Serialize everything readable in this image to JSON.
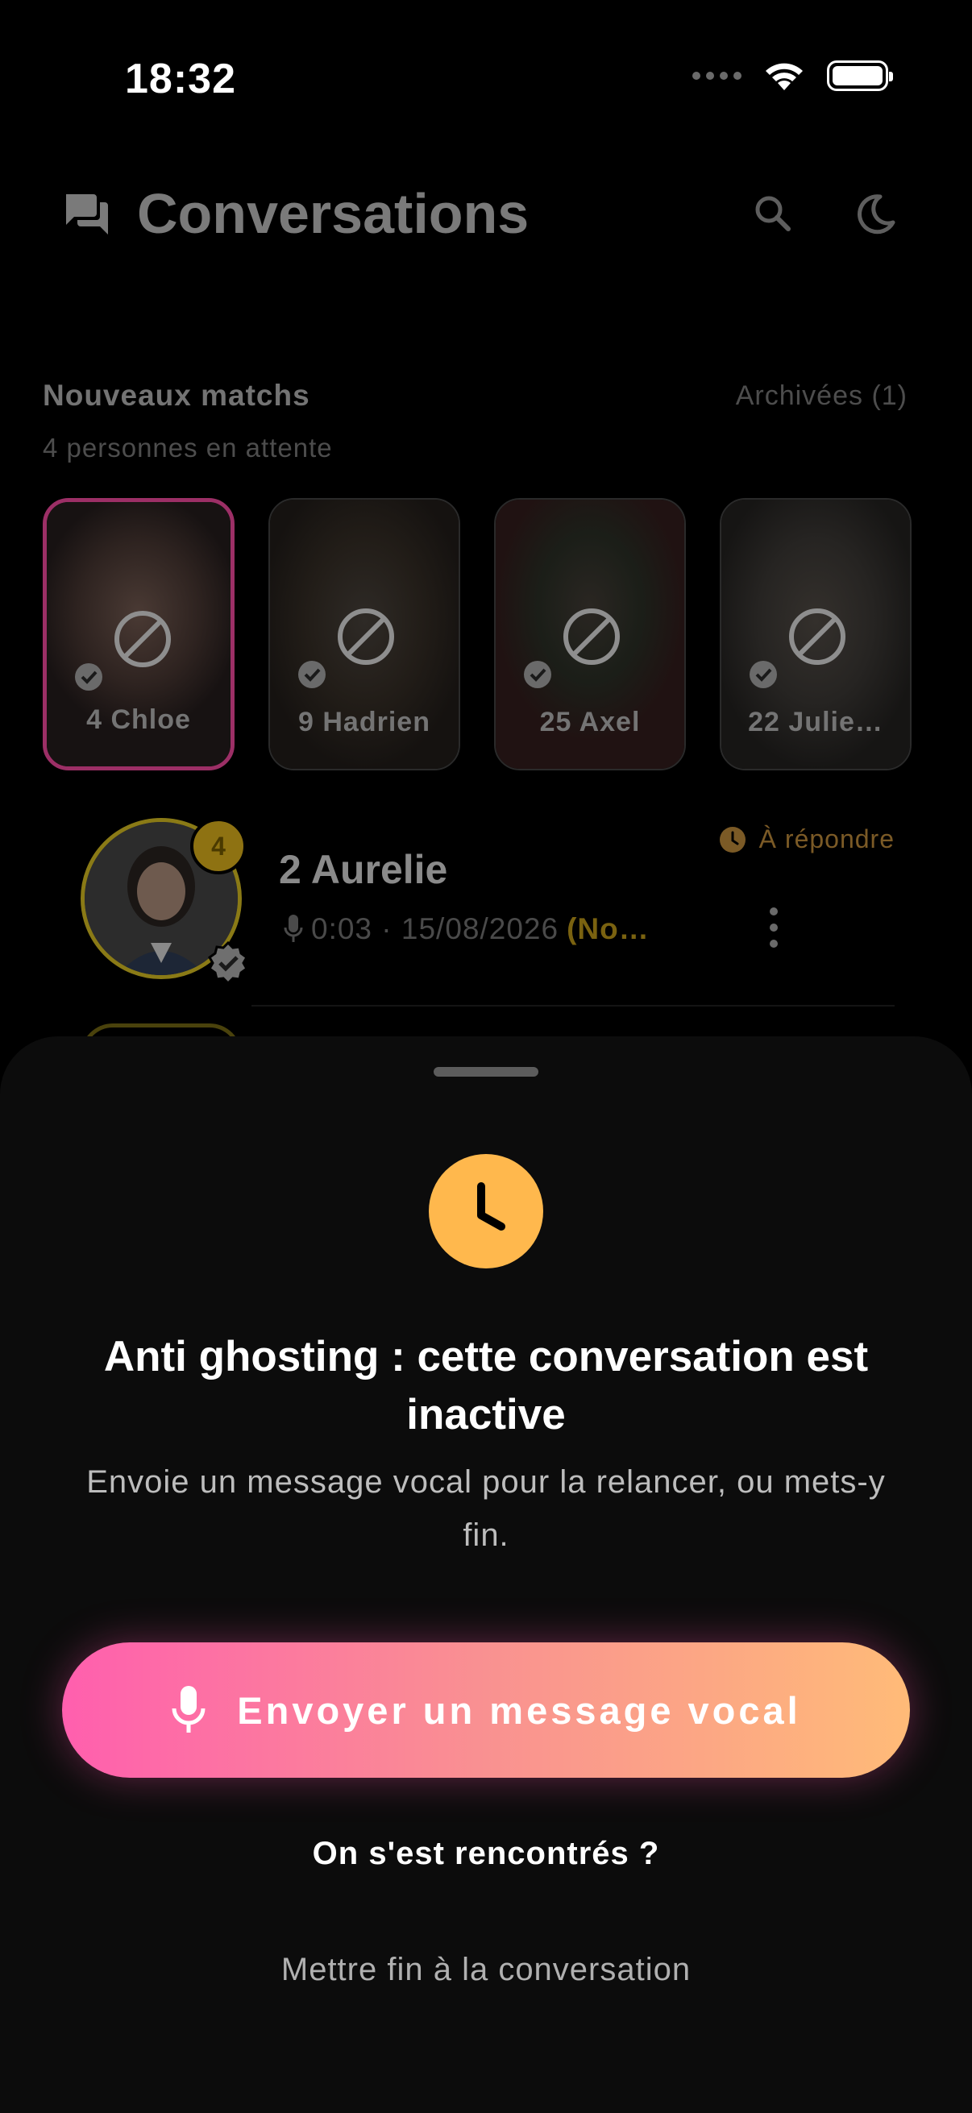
{
  "status_bar": {
    "time": "18:32"
  },
  "header": {
    "title": "Conversations"
  },
  "new_matches": {
    "title": "Nouveaux matchs",
    "subtitle": "4 personnes en attente",
    "archives_label": "Archivées (1)",
    "cards": [
      {
        "label": "4 Chloe",
        "selected": true
      },
      {
        "label": "9 Hadrien",
        "selected": false
      },
      {
        "label": "25 Axel",
        "selected": false
      },
      {
        "label": "22 Julie…",
        "selected": false
      }
    ]
  },
  "conversation": {
    "name": "2 Aurelie",
    "badge_count": "4",
    "status": "À répondre",
    "meta": "0:03 · 15/08/2026",
    "meta_highlight": "(No…"
  },
  "sheet": {
    "title": "Anti ghosting : cette conversation est inactive",
    "description": "Envoie un message vocal pour la relancer, ou mets-y fin.",
    "primary_button": "Envoyer un message vocal",
    "secondary_link": "On s'est rencontrés ?",
    "tertiary_link": "Mettre fin à la conversation"
  },
  "colors": {
    "accent_gradient_start": "#ff5fae",
    "accent_gradient_end": "#ffbb78",
    "clock_yellow": "#ffb84d",
    "status_orange": "#7b5a26"
  },
  "icons": {
    "header": "chat-bubbles-icon",
    "search": "search-icon",
    "theme": "moon-icon",
    "blocked": "blocked-icon",
    "verified": "verified-badge-icon",
    "clock": "clock-icon",
    "mic": "microphone-icon",
    "more": "more-vertical-icon"
  }
}
